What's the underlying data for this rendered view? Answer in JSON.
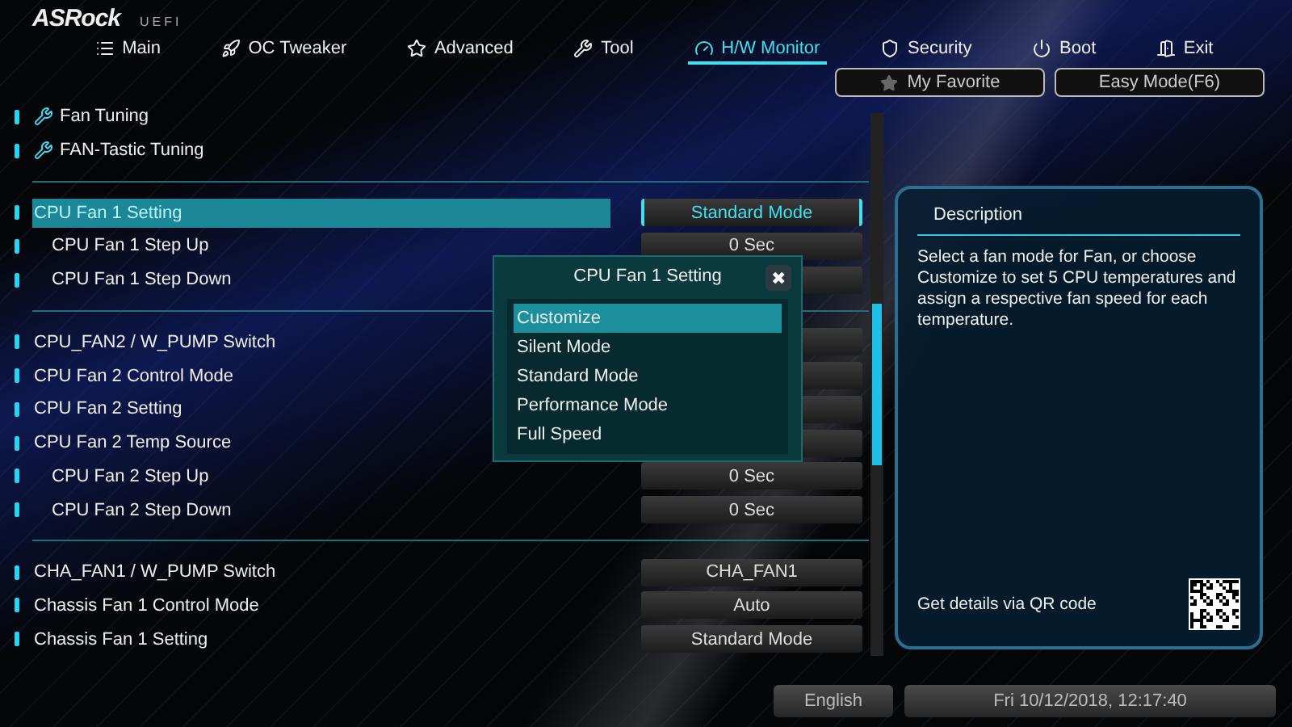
{
  "logo": {
    "brand": "ASRock",
    "suffix": "UEFI"
  },
  "tabs": [
    {
      "label": "Main",
      "selected": false
    },
    {
      "label": "OC Tweaker",
      "selected": false
    },
    {
      "label": "Advanced",
      "selected": false
    },
    {
      "label": "Tool",
      "selected": false
    },
    {
      "label": "H/W Monitor",
      "selected": true
    },
    {
      "label": "Security",
      "selected": false
    },
    {
      "label": "Boot",
      "selected": false
    },
    {
      "label": "Exit",
      "selected": false
    }
  ],
  "top_buttons": [
    "My Favorite",
    "Easy Mode(F6)"
  ],
  "sections": [
    {
      "items": [
        {
          "kind": "link",
          "label": "Fan Tuning",
          "selected": false
        },
        {
          "kind": "link",
          "label": "FAN-Tastic Tuning",
          "selected": false
        }
      ]
    },
    {
      "items": [
        {
          "kind": "setting",
          "label": "CPU Fan 1 Setting",
          "value": "Standard Mode",
          "selected": true,
          "children": [
            {
              "kind": "setting",
              "label": "CPU Fan 1 Step Up",
              "value": "0 Sec",
              "selected": false
            },
            {
              "kind": "setting",
              "label": "CPU Fan 1 Step Down",
              "selected": false
            }
          ]
        }
      ]
    },
    {
      "items": [
        {
          "kind": "setting",
          "label": "CPU_FAN2 / W_PUMP Switch",
          "selected": false
        },
        {
          "kind": "setting",
          "label": "CPU Fan 2 Control Mode",
          "selected": false
        },
        {
          "kind": "setting",
          "label": "CPU Fan 2 Setting",
          "selected": false
        },
        {
          "kind": "setting",
          "label": "CPU Fan 2 Temp Source",
          "selected": false,
          "children": [
            {
              "kind": "setting",
              "label": "CPU Fan 2 Step Up",
              "value": "0 Sec",
              "selected": false
            },
            {
              "kind": "setting",
              "label": "CPU Fan 2 Step Down",
              "value": "0 Sec",
              "selected": false
            }
          ]
        }
      ]
    },
    {
      "items": [
        {
          "kind": "setting",
          "label": "CHA_FAN1 / W_PUMP Switch",
          "value": "CHA_FAN1",
          "selected": false
        },
        {
          "kind": "setting",
          "label": "Chassis Fan 1 Control Mode",
          "value": "Auto",
          "selected": false
        },
        {
          "kind": "setting",
          "label": "Chassis Fan 1 Setting",
          "value": "Standard Mode",
          "selected": false
        }
      ]
    }
  ],
  "popup": {
    "title": "CPU Fan 1 Setting",
    "close": "✖",
    "options": [
      {
        "label": "Customize",
        "selected": true
      },
      {
        "label": "Silent Mode",
        "selected": false
      },
      {
        "label": "Standard Mode",
        "selected": false
      },
      {
        "label": "Performance Mode",
        "selected": false
      },
      {
        "label": "Full Speed",
        "selected": false
      }
    ]
  },
  "description": {
    "title": "Description",
    "text": "Select a fan mode for Fan, or choose Customize to set 5 CPU temperatures and assign a respective fan speed for each temperature.",
    "qr_label": "Get details via QR code"
  },
  "footer": {
    "language": "English",
    "datetime": "Fri 10/12/2018, 12:17:40"
  }
}
